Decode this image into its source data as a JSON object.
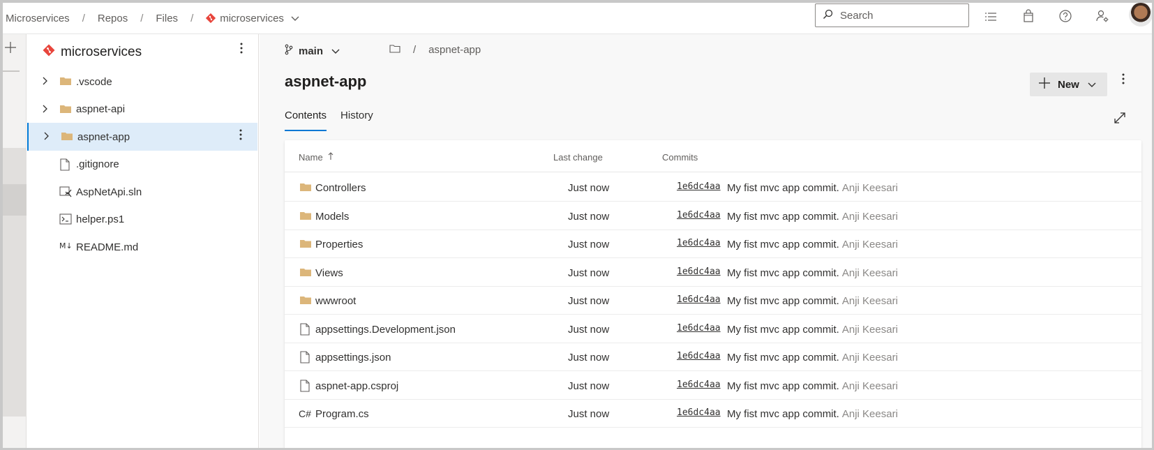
{
  "breadcrumb": {
    "org": "Microservices",
    "section": "Repos",
    "page": "Files",
    "repo": "microservices"
  },
  "search": {
    "placeholder": "Search"
  },
  "top_icons": [
    "task-list-icon",
    "bag-icon",
    "help-icon",
    "user-settings-icon"
  ],
  "colors": {
    "accent": "#0078d4",
    "folder": "#dcb67a",
    "repo": "#e8453c",
    "selected_bg": "#deecf9"
  },
  "tree": {
    "repo_name": "microservices",
    "items": [
      {
        "label": ".vscode",
        "type": "folder",
        "expandable": true,
        "selected": false
      },
      {
        "label": "aspnet-api",
        "type": "folder",
        "expandable": true,
        "selected": false
      },
      {
        "label": "aspnet-app",
        "type": "folder",
        "expandable": true,
        "selected": true
      },
      {
        "label": ".gitignore",
        "type": "file",
        "expandable": false,
        "selected": false
      },
      {
        "label": "AspNetApi.sln",
        "type": "sln",
        "expandable": false,
        "selected": false
      },
      {
        "label": "helper.ps1",
        "type": "ps1",
        "expandable": false,
        "selected": false
      },
      {
        "label": "README.md",
        "type": "md",
        "expandable": false,
        "selected": false
      }
    ]
  },
  "main": {
    "branch": "main",
    "path": "aspnet-app",
    "title": "aspnet-app",
    "new_button": "New",
    "tabs": [
      {
        "label": "Contents",
        "active": true
      },
      {
        "label": "History",
        "active": false
      }
    ],
    "table": {
      "headers": {
        "name": "Name",
        "last_change": "Last change",
        "commits": "Commits"
      },
      "rows": [
        {
          "name": "Controllers",
          "type": "folder",
          "last_change": "Just now",
          "hash": "1e6dc4aa",
          "message": "My fist mvc app commit.",
          "author": "Anji Keesari"
        },
        {
          "name": "Models",
          "type": "folder",
          "last_change": "Just now",
          "hash": "1e6dc4aa",
          "message": "My fist mvc app commit.",
          "author": "Anji Keesari"
        },
        {
          "name": "Properties",
          "type": "folder",
          "last_change": "Just now",
          "hash": "1e6dc4aa",
          "message": "My fist mvc app commit.",
          "author": "Anji Keesari"
        },
        {
          "name": "Views",
          "type": "folder",
          "last_change": "Just now",
          "hash": "1e6dc4aa",
          "message": "My fist mvc app commit.",
          "author": "Anji Keesari"
        },
        {
          "name": "wwwroot",
          "type": "folder",
          "last_change": "Just now",
          "hash": "1e6dc4aa",
          "message": "My fist mvc app commit.",
          "author": "Anji Keesari"
        },
        {
          "name": "appsettings.Development.json",
          "type": "file",
          "last_change": "Just now",
          "hash": "1e6dc4aa",
          "message": "My fist mvc app commit.",
          "author": "Anji Keesari"
        },
        {
          "name": "appsettings.json",
          "type": "file",
          "last_change": "Just now",
          "hash": "1e6dc4aa",
          "message": "My fist mvc app commit.",
          "author": "Anji Keesari"
        },
        {
          "name": "aspnet-app.csproj",
          "type": "file",
          "last_change": "Just now",
          "hash": "1e6dc4aa",
          "message": "My fist mvc app commit.",
          "author": "Anji Keesari"
        },
        {
          "name": "Program.cs",
          "type": "csharp",
          "csharp_label": "C#",
          "last_change": "Just now",
          "hash": "1e6dc4aa",
          "message": "My fist mvc app commit.",
          "author": "Anji Keesari"
        }
      ]
    }
  }
}
